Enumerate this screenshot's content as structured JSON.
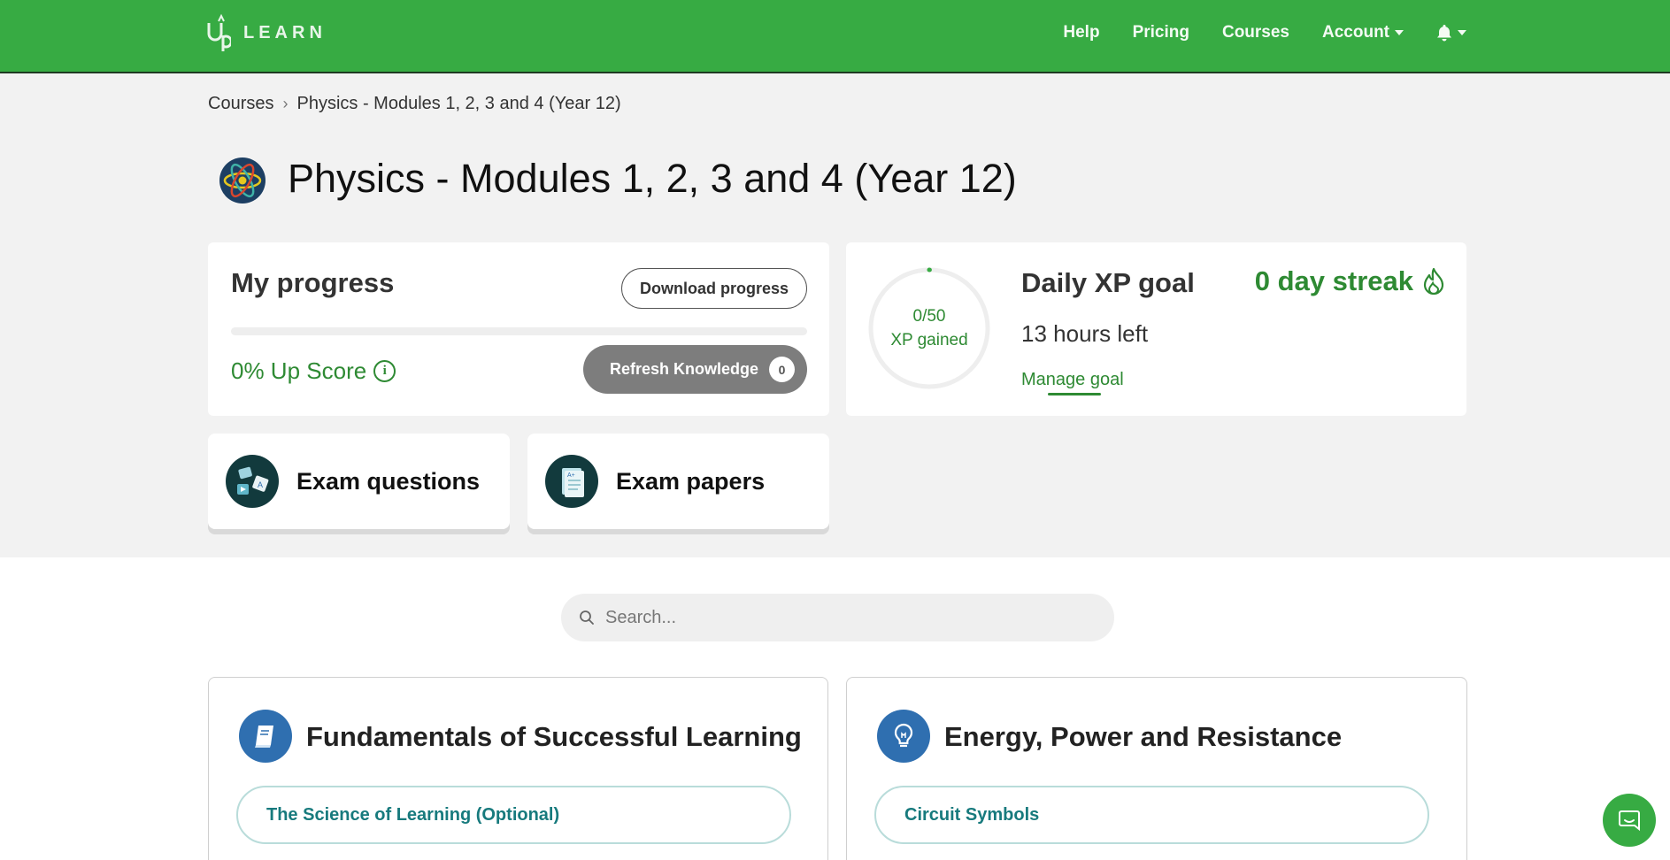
{
  "header": {
    "logo_text": "LEARN",
    "nav": {
      "help": "Help",
      "pricing": "Pricing",
      "courses": "Courses",
      "account": "Account"
    },
    "colors": {
      "brand": "#37ab43",
      "accent_text": "#2e8a33"
    }
  },
  "breadcrumb": {
    "root": "Courses",
    "current": "Physics - Modules 1, 2, 3 and 4 (Year 12)"
  },
  "course": {
    "title": "Physics - Modules 1, 2, 3 and 4 (Year 12)",
    "icon": "atom-icon"
  },
  "progress": {
    "title": "My progress",
    "download_label": "Download progress",
    "percent": 0,
    "upscore_label": "0% Up Score",
    "refresh_label": "Refresh Knowledge",
    "refresh_count": "0"
  },
  "xp": {
    "gained": "0/50",
    "gained_label": "XP gained",
    "fraction": 0,
    "title": "Daily XP goal",
    "hours_left": "13 hours left",
    "manage_label": "Manage goal",
    "streak": "0 day streak"
  },
  "tiles": [
    {
      "label": "Exam questions",
      "icon": "exam-questions-icon"
    },
    {
      "label": "Exam papers",
      "icon": "exam-papers-icon"
    }
  ],
  "search": {
    "placeholder": "Search..."
  },
  "modules": [
    {
      "title": "Fundamentals of Successful Learning",
      "icon": "book-icon",
      "lesson": "The Science of Learning (Optional)"
    },
    {
      "title": "Energy, Power and Resistance",
      "icon": "lightbulb-icon",
      "lesson": "Circuit Symbols"
    }
  ]
}
